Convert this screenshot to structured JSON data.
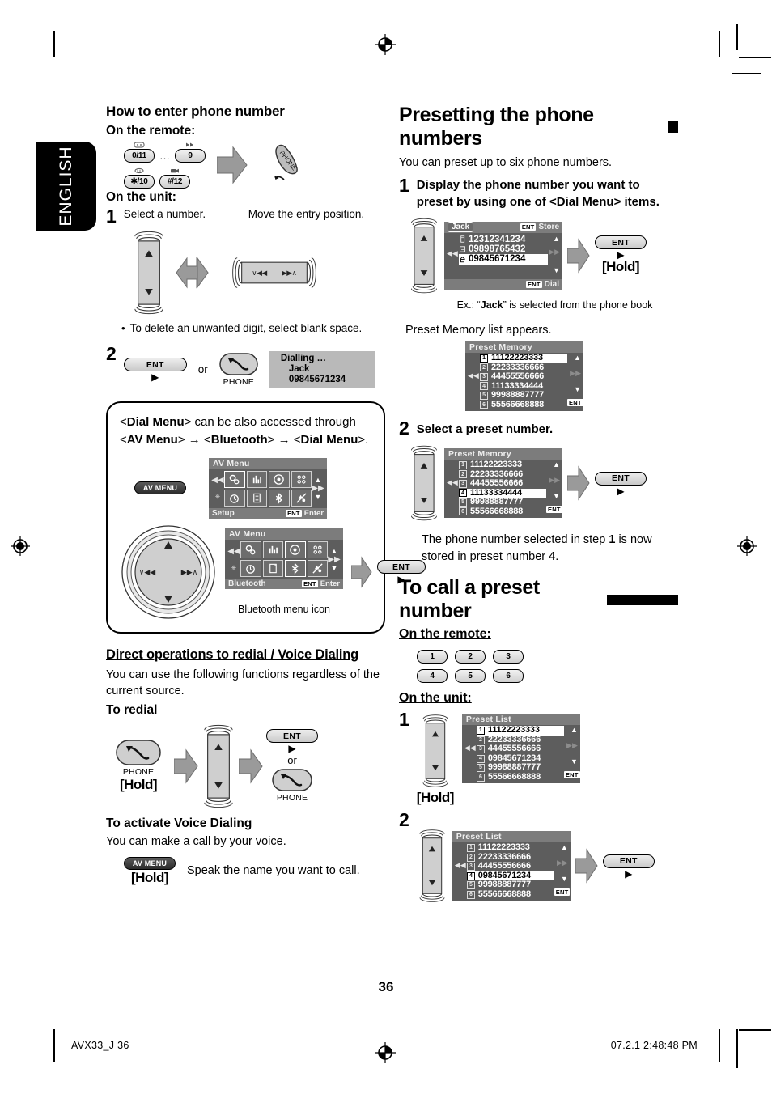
{
  "page": {
    "language_tab": "ENGLISH",
    "page_number": "36",
    "footer_left": "AVX33_J  36",
    "footer_right": "07.2.1   2:48:48 PM"
  },
  "left_column": {
    "section1": {
      "heading": "How to enter phone number",
      "on_remote_label": "On the remote:",
      "remote_keys": [
        {
          "label": "0/11",
          "top_icon": "subtitle-icon"
        },
        {
          "label": "…",
          "top_icon": ""
        },
        {
          "label": "9",
          "top_icon": "fast-forward-icon"
        },
        {
          "label": "✱/10",
          "top_icon": "repeat-icon"
        },
        {
          "label": "#/12",
          "top_icon": "video-icon"
        }
      ],
      "phone_button_label": "PHONE",
      "on_unit_label": "On the unit:",
      "step1_num": "1",
      "step1_left_caption": "Select a number.",
      "step1_right_caption": "Move the entry position.",
      "bullet": "To delete an unwanted digit, select blank space.",
      "step2_num": "2",
      "ent_label": "ENT",
      "or_label": "or",
      "phone_label": "PHONE",
      "dialling_display": {
        "line1": "Dialling …",
        "line2": "Jack",
        "line3": "09845671234"
      }
    },
    "note_box": {
      "text_parts": [
        {
          "t": "<",
          "b": false
        },
        {
          "t": "Dial Menu",
          "b": true
        },
        {
          "t": "> can be also accessed through <",
          "b": false
        },
        {
          "t": "AV Menu",
          "b": true
        },
        {
          "t": "> → <",
          "b": false
        },
        {
          "t": "Bluetooth",
          "b": true
        },
        {
          "t": "> → <",
          "b": false
        },
        {
          "t": "Dial Menu",
          "b": true
        },
        {
          "t": ">.",
          "b": false
        }
      ],
      "av_menu_button": "AV MENU",
      "screen1": {
        "title": "AV Menu",
        "footer_left": "Setup",
        "footer_ent": "ENT",
        "footer_enter": "Enter"
      },
      "screen2": {
        "title": "AV Menu",
        "footer_left": "Bluetooth",
        "footer_ent": "ENT",
        "footer_enter": "Enter"
      },
      "ent_label": "ENT",
      "icon_caption": "Bluetooth menu icon"
    },
    "section2": {
      "heading": "Direct operations to redial / Voice Dialing",
      "intro": "You can use the following functions regardless of the current source.",
      "redial_heading": "To redial",
      "phone_label": "PHONE",
      "hold_label": "[Hold]",
      "ent_label": "ENT",
      "or_label": "or",
      "phone_label2": "PHONE",
      "voice_heading": "To activate Voice Dialing",
      "voice_intro": "You can make a call by your voice.",
      "av_menu_button": "AV MENU",
      "voice_hold": "[Hold]",
      "voice_caption": "Speak the name you want to call."
    }
  },
  "right_column": {
    "section_preset": {
      "heading": "Presetting the phone numbers",
      "intro": "You can preset up to six phone numbers.",
      "step1_num": "1",
      "step1_text": "Display the phone number you want to preset by using one of <Dial Menu> items.",
      "dial_screen": {
        "name_tag": "Jack",
        "ent_chip": "ENT",
        "store_label": "Store",
        "rows": [
          {
            "icon": "mobile-icon",
            "value": "12312341234",
            "selected": false
          },
          {
            "icon": "office-icon",
            "value": "09898765432",
            "selected": false
          },
          {
            "icon": "home-icon",
            "value": "09845671234",
            "selected": true
          }
        ],
        "footer_ent": "ENT",
        "footer_label": "Dial"
      },
      "ent_label": "ENT",
      "hold_label": "[Hold]",
      "example_prefix": "Ex.: “",
      "example_bold": "Jack",
      "example_suffix": "” is selected from the phone book",
      "list_appears": "Preset Memory list appears.",
      "preset_memory_1": {
        "title": "Preset Memory",
        "rows": [
          {
            "idx": "1",
            "value": "11122223333",
            "selected": true
          },
          {
            "idx": "2",
            "value": "22233336666",
            "selected": false
          },
          {
            "idx": "3",
            "value": "44455556666",
            "selected": false
          },
          {
            "idx": "4",
            "value": "11133334444",
            "selected": false
          },
          {
            "idx": "5",
            "value": "99988887777",
            "selected": false
          },
          {
            "idx": "6",
            "value": "55566668888",
            "selected": false
          }
        ],
        "ent_chip": "ENT"
      },
      "step2_num": "2",
      "step2_text": "Select a preset number.",
      "preset_memory_2": {
        "title": "Preset Memory",
        "rows": [
          {
            "idx": "1",
            "value": "11122223333",
            "selected": false
          },
          {
            "idx": "2",
            "value": "22233336666",
            "selected": false
          },
          {
            "idx": "3",
            "value": "44455556666",
            "selected": false
          },
          {
            "idx": "4",
            "value": "11133334444",
            "selected": true
          },
          {
            "idx": "5",
            "value": "99988887777",
            "selected": false
          },
          {
            "idx": "6",
            "value": "55566668888",
            "selected": false
          }
        ],
        "ent_chip": "ENT"
      },
      "ent_label2": "ENT",
      "result_text_1": "The phone number selected in step ",
      "result_step": "1",
      "result_text_2": " is now stored in preset number 4."
    },
    "section_call": {
      "heading": "To call a preset number",
      "on_remote_label": "On the remote:",
      "remote_keys": [
        "1",
        "2",
        "3",
        "4",
        "5",
        "6"
      ],
      "on_unit_label": "On the unit:",
      "step1_num": "1",
      "hold_label": "[Hold]",
      "preset_list_1": {
        "title": "Preset List",
        "rows": [
          {
            "idx": "1",
            "value": "11122223333",
            "selected": true
          },
          {
            "idx": "2",
            "value": "22233336666",
            "selected": false
          },
          {
            "idx": "3",
            "value": "44455556666",
            "selected": false
          },
          {
            "idx": "4",
            "value": "09845671234",
            "selected": false
          },
          {
            "idx": "5",
            "value": "99988887777",
            "selected": false
          },
          {
            "idx": "6",
            "value": "55566668888",
            "selected": false
          }
        ],
        "ent_chip": "ENT"
      },
      "step2_num": "2",
      "preset_list_2": {
        "title": "Preset List",
        "rows": [
          {
            "idx": "1",
            "value": "11122223333",
            "selected": false
          },
          {
            "idx": "2",
            "value": "22233336666",
            "selected": false
          },
          {
            "idx": "3",
            "value": "44455556666",
            "selected": false
          },
          {
            "idx": "4",
            "value": "09845671234",
            "selected": true
          },
          {
            "idx": "5",
            "value": "99988887777",
            "selected": false
          },
          {
            "idx": "6",
            "value": "55566668888",
            "selected": false
          }
        ],
        "ent_chip": "ENT"
      },
      "ent_label": "ENT"
    }
  },
  "colors": {
    "lcd_background": "#5d5d5d",
    "lcd_title_bar": "#7c7c7c",
    "grey_arrow": "#9a9a9a",
    "button_face": "#d0d0d0"
  }
}
